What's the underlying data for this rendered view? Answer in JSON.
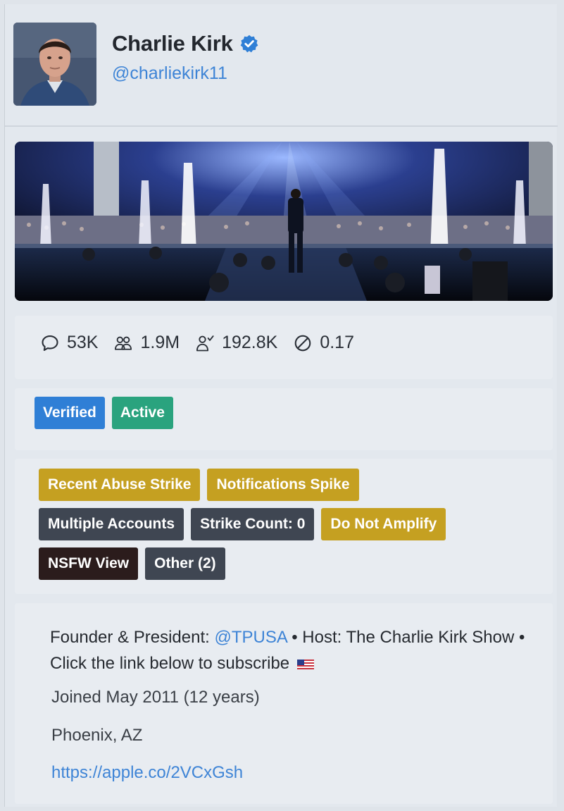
{
  "profile": {
    "name": "Charlie Kirk",
    "handle": "@charliekirk11"
  },
  "stats": {
    "replies": "53K",
    "followers": "1.9M",
    "following": "192.8K",
    "ratio": "0.17"
  },
  "status_badges": {
    "verified": "Verified",
    "active": "Active"
  },
  "flags": {
    "recent_abuse_strike": "Recent Abuse Strike",
    "notifications_spike": "Notifications Spike",
    "multiple_accounts": "Multiple Accounts",
    "strike_count": "Strike Count: 0",
    "do_not_amplify": "Do Not Amplify",
    "nsfw_view": "NSFW View",
    "other": "Other (2)"
  },
  "bio": {
    "prefix": "Founder & President: ",
    "mention": "@TPUSA",
    "suffix": " • Host: The Charlie Kirk Show • Click the link below to subscribe",
    "joined": "Joined May 2011 (12 years)",
    "location": "Phoenix, AZ",
    "url": "https://apple.co/2VCxGsh"
  },
  "colors": {
    "verified_blue": "#2f7fd6",
    "active_green": "#2aa37e",
    "warning_gold": "#c5a021",
    "slate": "#3f4652",
    "link_blue": "#3e84d6"
  },
  "icons": {
    "replies": "speech-bubble-icon",
    "followers": "group-icon",
    "following": "user-check-icon",
    "ratio": "ban-circle-icon",
    "verified": "verified-check-icon"
  }
}
